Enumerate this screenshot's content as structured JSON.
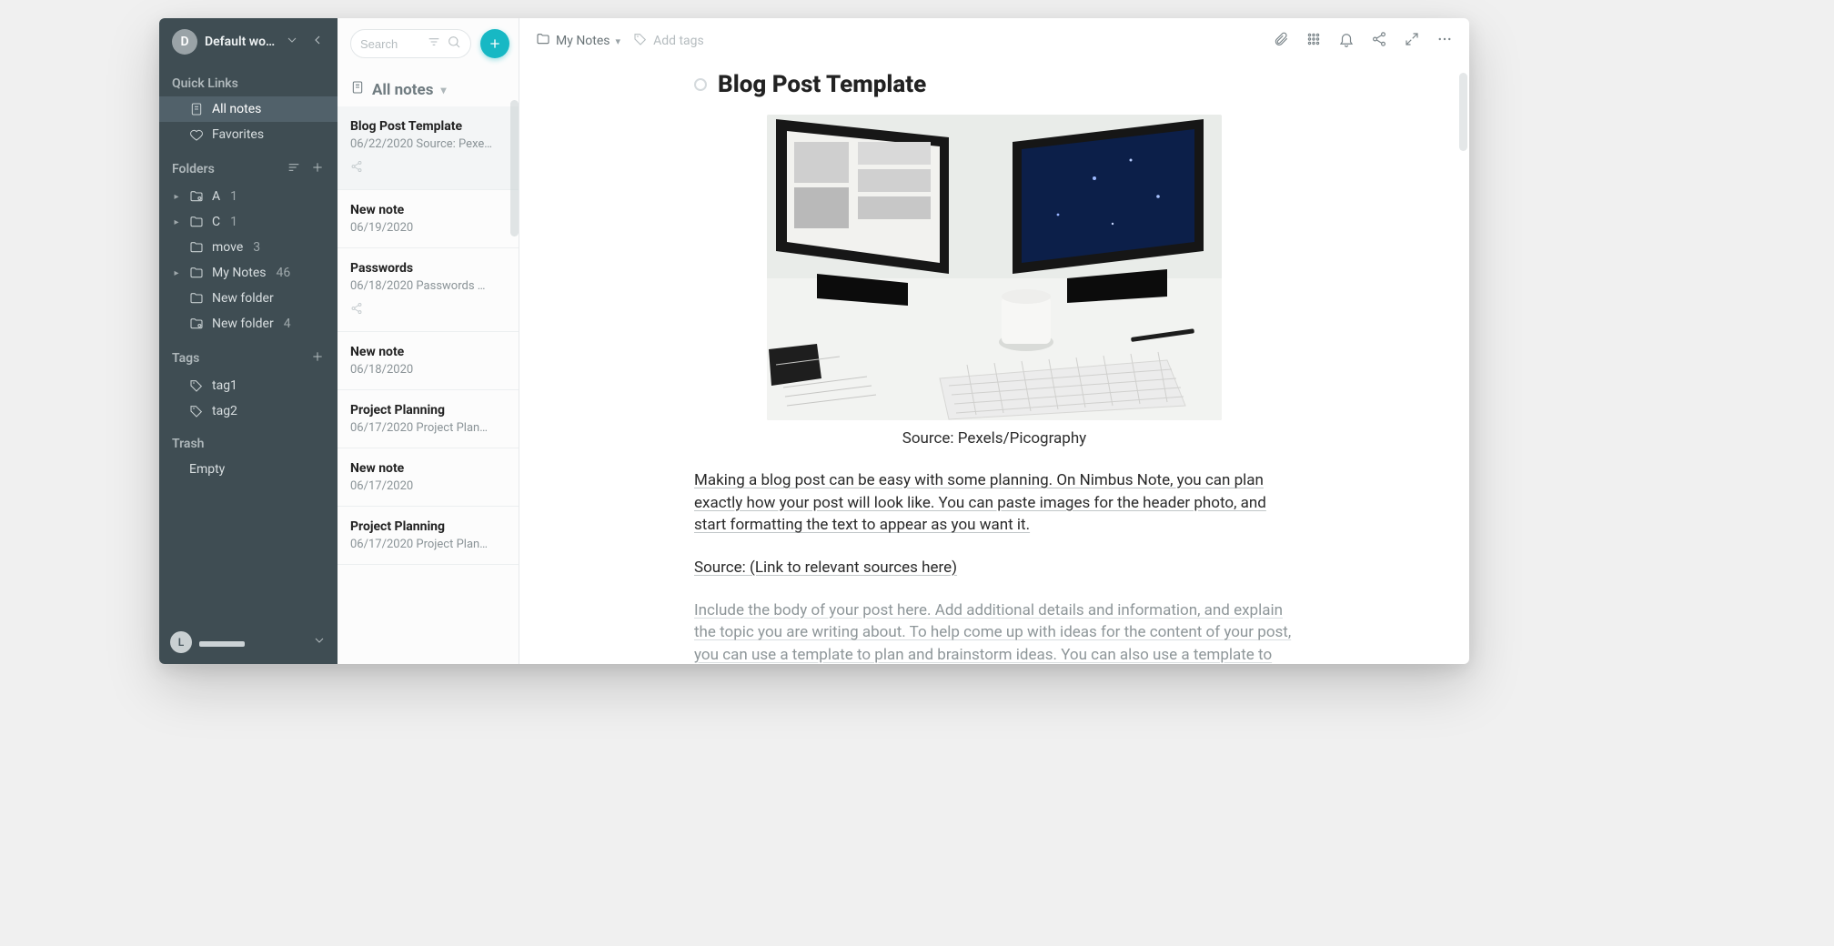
{
  "workspace": {
    "initial": "D",
    "name": "Default wor…"
  },
  "search": {
    "placeholder": "Search"
  },
  "sidebar": {
    "quick_heading": "Quick Links",
    "quick": [
      {
        "label": "All notes",
        "active": true,
        "icon": "note-icon"
      },
      {
        "label": "Favorites",
        "active": false,
        "icon": "heart-icon"
      }
    ],
    "folders_heading": "Folders",
    "folders": [
      {
        "label": "A",
        "count": "1",
        "icon": "folder-shared-icon",
        "expandable": true
      },
      {
        "label": "C",
        "count": "1",
        "icon": "folder-icon",
        "expandable": true
      },
      {
        "label": "move",
        "count": "3",
        "icon": "folder-icon",
        "expandable": false
      },
      {
        "label": "My Notes",
        "count": "46",
        "icon": "folder-icon",
        "expandable": true
      },
      {
        "label": "New folder",
        "count": "",
        "icon": "folder-icon",
        "expandable": false
      },
      {
        "label": "New folder",
        "count": "4",
        "icon": "folder-shared-icon",
        "expandable": false
      }
    ],
    "tags_heading": "Tags",
    "tags": [
      {
        "label": "tag1"
      },
      {
        "label": "tag2"
      }
    ],
    "trash_heading": "Trash",
    "trash_label": "Empty",
    "user_initial": "L"
  },
  "notelist": {
    "heading": "All notes",
    "items": [
      {
        "title": "Blog Post Template",
        "date": "06/22/2020",
        "preview": "Source: Pexe…",
        "shared": true,
        "selected": true
      },
      {
        "title": "New note",
        "date": "06/19/2020",
        "preview": "",
        "shared": false,
        "selected": false
      },
      {
        "title": "Passwords",
        "date": "06/18/2020",
        "preview": "Passwords …",
        "shared": true,
        "selected": false
      },
      {
        "title": "New note",
        "date": "06/18/2020",
        "preview": "",
        "shared": false,
        "selected": false
      },
      {
        "title": "Project Planning",
        "date": "06/17/2020",
        "preview": "Project Plan…",
        "shared": false,
        "selected": false
      },
      {
        "title": "New note",
        "date": "06/17/2020",
        "preview": "",
        "shared": false,
        "selected": false
      },
      {
        "title": "Project Planning",
        "date": "06/17/2020",
        "preview": "Project Plan…",
        "shared": false,
        "selected": false
      }
    ]
  },
  "main": {
    "breadcrumb_folder": "My Notes",
    "add_tags_label": "Add tags",
    "title": "Blog Post Template",
    "caption": "Source: Pexels/Picography",
    "body": [
      "Making a blog post can be easy with some planning. On Nimbus Note, you can plan exactly how your post will look like. You can paste images for the header photo, and start formatting the text to appear as you want it.",
      "Source: (Link to relevant sources here)",
      "Include the body of your post here. Add additional details and information, and explain the topic you are writing about. To help come up with ideas for the content of your post, you can use a template to plan and brainstorm ideas. You can also use a template to lay out relevant keywords, deadlines, and revisions."
    ]
  }
}
